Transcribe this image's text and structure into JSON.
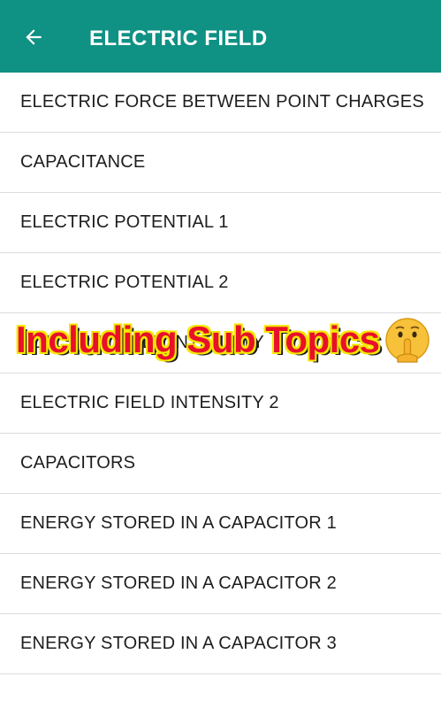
{
  "toolbar": {
    "title": "ELECTRIC FIELD",
    "back_icon": "arrow-left-icon",
    "color": "#0f9184"
  },
  "topics": [
    {
      "label": "ELECTRIC FORCE BETWEEN POINT CHARGES"
    },
    {
      "label": "CAPACITANCE"
    },
    {
      "label": "ELECTRIC POTENTIAL 1"
    },
    {
      "label": "ELECTRIC POTENTIAL 2"
    },
    {
      "label": "ELECTRIC FIELD INTENSITY"
    },
    {
      "label": "ELECTRIC FIELD INTENSITY 2"
    },
    {
      "label": "CAPACITORS"
    },
    {
      "label": "ENERGY STORED IN A CAPACITOR 1"
    },
    {
      "label": "ENERGY STORED IN A CAPACITOR 2"
    },
    {
      "label": "ENERGY STORED IN A CAPACITOR 3"
    }
  ],
  "overlay": {
    "text": "Including Sub Topics",
    "emoji_icon": "shushing-face-emoji-icon",
    "text_color": "#e8102a",
    "outline_color": "#f5e600"
  }
}
